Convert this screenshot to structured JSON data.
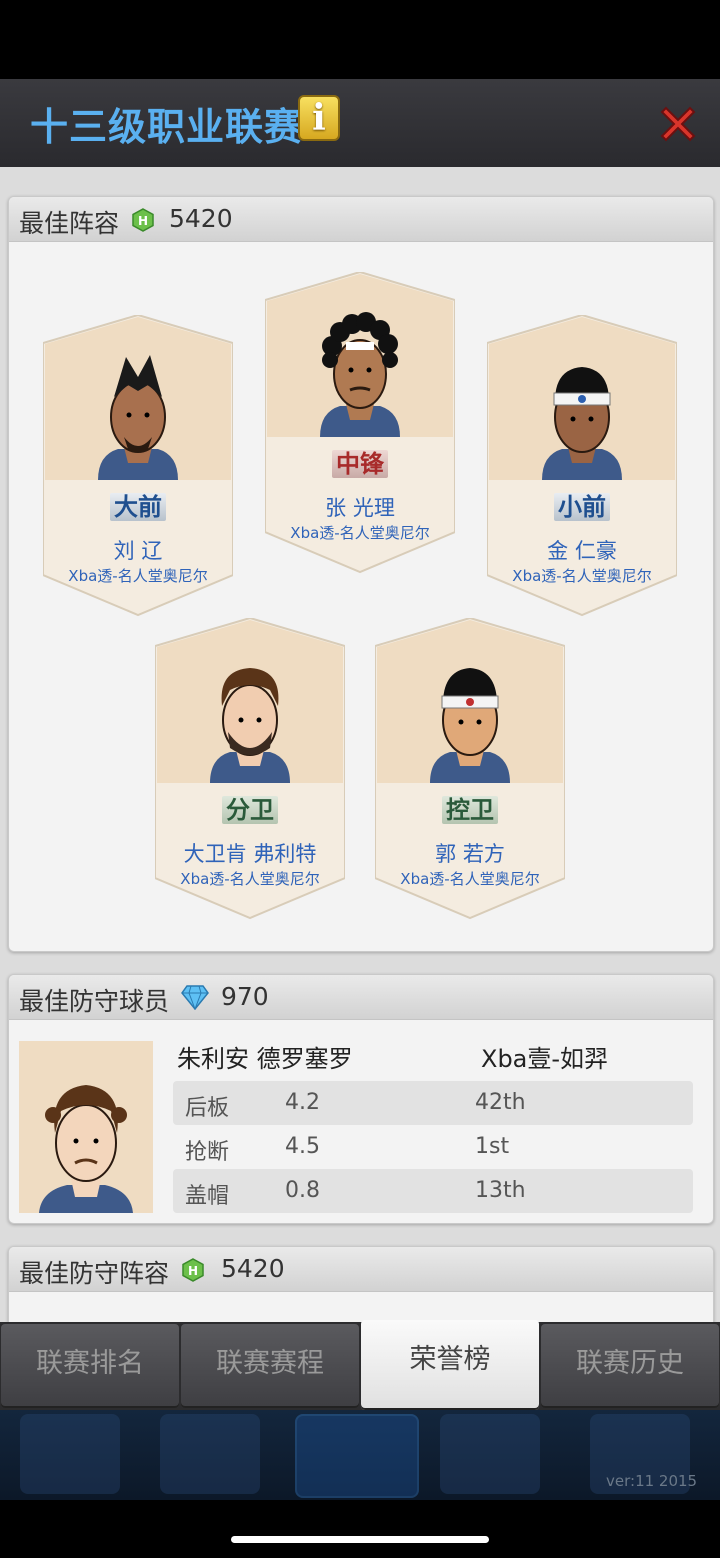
{
  "header": {
    "title": "十三级职业联赛",
    "info_glyph": "i",
    "close_icon": "close-x-icon"
  },
  "best_lineup": {
    "title": "最佳阵容",
    "score": "5420",
    "icon": "green-hexagon-badge-icon",
    "players": [
      {
        "position": "大前",
        "name": "刘 辽",
        "team": "Xba透-名人堂奥尼尔"
      },
      {
        "position": "中锋",
        "name": "张 光理",
        "team": "Xba透-名人堂奥尼尔"
      },
      {
        "position": "小前",
        "name": "金 仁豪",
        "team": "Xba透-名人堂奥尼尔"
      },
      {
        "position": "分卫",
        "name": "大卫肯 弗利特",
        "team": "Xba透-名人堂奥尼尔"
      },
      {
        "position": "控卫",
        "name": "郭 若方",
        "team": "Xba透-名人堂奥尼尔"
      }
    ]
  },
  "best_defender": {
    "title": "最佳防守球员",
    "score": "970",
    "icon": "diamond-icon",
    "player_name": "朱利安 德罗塞罗",
    "team": "Xba壹-如羿",
    "stats": [
      {
        "label": "后板",
        "value": "4.2",
        "rank": "42th"
      },
      {
        "label": "抢断",
        "value": "4.5",
        "rank": "1st"
      },
      {
        "label": "盖帽",
        "value": "0.8",
        "rank": "13th"
      }
    ]
  },
  "best_defensive_lineup": {
    "title": "最佳防守阵容",
    "score": "5420",
    "icon": "green-hexagon-badge-icon"
  },
  "tabs": [
    {
      "label": "联赛排名",
      "active": false
    },
    {
      "label": "联赛赛程",
      "active": false
    },
    {
      "label": "荣誉榜",
      "active": true
    },
    {
      "label": "联赛历史",
      "active": false
    }
  ],
  "footer": {
    "version": "ver:11  2015"
  },
  "colors": {
    "title_blue": "#5ab0f0",
    "name_blue": "#2f63b9",
    "card_beige": "#efdcc2",
    "accent_red": "#d9352b"
  }
}
